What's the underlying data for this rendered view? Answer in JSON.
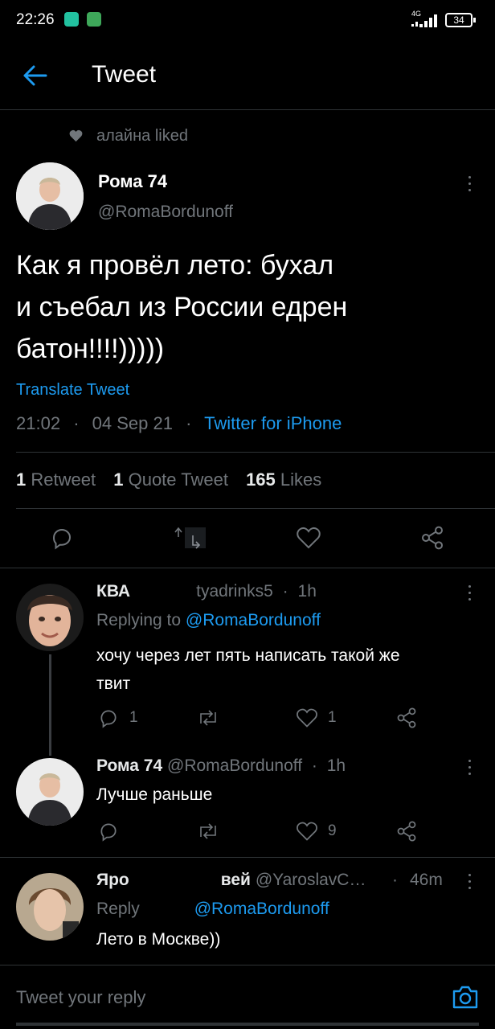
{
  "status_bar": {
    "time": "22:26",
    "network": "4G",
    "battery": "34"
  },
  "header": {
    "title": "Tweet"
  },
  "social_context": {
    "text": "алайна liked"
  },
  "tweet": {
    "author_name": "Рома 74",
    "author_handle": "@RomaBordunoff",
    "text_lines": [
      "Как я провёл лето: бухал",
      "и съебал из России едрен",
      "батон!!!!)))))"
    ],
    "translate": "Translate Tweet",
    "time": "21:02",
    "date": "04 Sep 21",
    "source": "Twitter for iPhone",
    "stats": {
      "retweets": "1",
      "retweets_label": "Retweet",
      "quotes": "1",
      "quotes_label": "Quote Tweet",
      "likes": "165",
      "likes_label": "Likes"
    }
  },
  "replies": [
    {
      "name": "КВА",
      "handle": "tyadrinks5",
      "time": "1h",
      "replying_prefix": "Replying to",
      "replying_handle": "@RomaBordunoff",
      "text_lines": [
        "хочу через лет пять написать такой же",
        "твит"
      ],
      "reply_count": "1",
      "like_count": "1"
    },
    {
      "name": "Рома 74",
      "handle": "@RomaBordunoff",
      "time": "1h",
      "text_lines": [
        "Лучше раньше"
      ],
      "like_count": "9"
    },
    {
      "name": "Яро",
      "name_end": "вей",
      "handle": "@YaroslavC…",
      "time": "46m",
      "replying_prefix": "Reply",
      "replying_handle": "@RomaBordunoff",
      "text_lines": [
        "Лето в Москве))"
      ]
    }
  ],
  "compose": {
    "placeholder": "Tweet your reply"
  },
  "colors": {
    "accent": "#1d9bf0",
    "muted": "#71767b",
    "background": "#000000",
    "divider": "#2f3336"
  },
  "icons": [
    "back-arrow-icon",
    "heart-icon",
    "reply-icon",
    "retweet-icon",
    "share-icon",
    "camera-icon",
    "more-icon"
  ]
}
